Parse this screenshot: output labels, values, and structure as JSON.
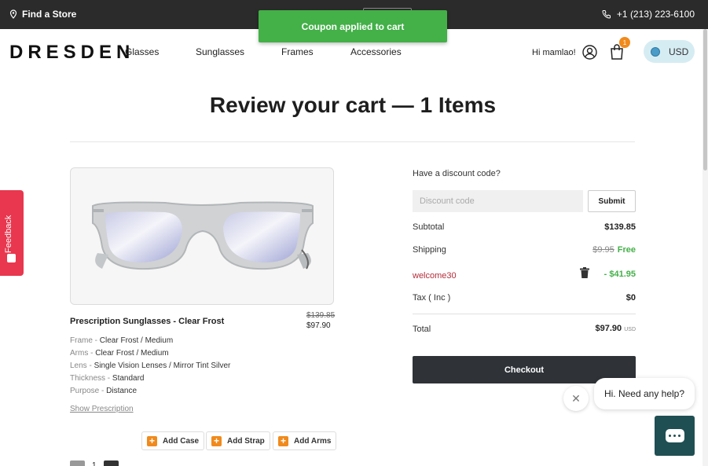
{
  "topbar": {
    "find_store": "Find a Store",
    "phone": "+1 (213) 223-6100"
  },
  "toast": {
    "message": "Coupon applied to cart"
  },
  "header": {
    "logo": "DRESDEN",
    "nav": [
      "Glasses",
      "Sunglasses",
      "Frames",
      "Accessories"
    ],
    "greeting": "Hi mamlao!",
    "cart_count": "1",
    "currency": "USD"
  },
  "page": {
    "title": "Review your cart — 1 Items"
  },
  "product": {
    "name": "Prescription Sunglasses - Clear Frost",
    "price_original": "$139.85",
    "price_current": "$97.90",
    "specs": [
      {
        "label": "Frame",
        "value": "Clear Frost / Medium"
      },
      {
        "label": "Arms",
        "value": "Clear Frost / Medium"
      },
      {
        "label": "Lens",
        "value": "Single Vision Lenses / Mirror Tint Silver"
      },
      {
        "label": "Thickness",
        "value": "Standard"
      },
      {
        "label": "Purpose",
        "value": "Distance"
      }
    ],
    "show_prescription": "Show Prescription",
    "addons": [
      "Add Case",
      "Add Strap",
      "Add Arms"
    ],
    "quantity": "1"
  },
  "summary": {
    "discount_label": "Have a discount code?",
    "discount_placeholder": "Discount code",
    "submit": "Submit",
    "subtotal_label": "Subtotal",
    "subtotal_value": "$139.85",
    "shipping_label": "Shipping",
    "shipping_old": "$9.95",
    "shipping_value": "Free",
    "coupon_code": "welcome30",
    "coupon_value": "- $41.95",
    "tax_label": "Tax ( Inc )",
    "tax_value": "$0",
    "total_label": "Total",
    "total_value": "$97.90",
    "total_currency": "USD",
    "checkout": "Checkout"
  },
  "feedback": {
    "label": "Feedback"
  },
  "chat": {
    "bubble": "Hi. Need any help?"
  },
  "colors": {
    "topbar": "#2b2b2b",
    "toast": "#43b048",
    "accent_orange": "#f08a1c",
    "checkout": "#2f3338",
    "coupon": "#b32d3a",
    "feedback": "#e8374e",
    "chat": "#1f4f53"
  }
}
